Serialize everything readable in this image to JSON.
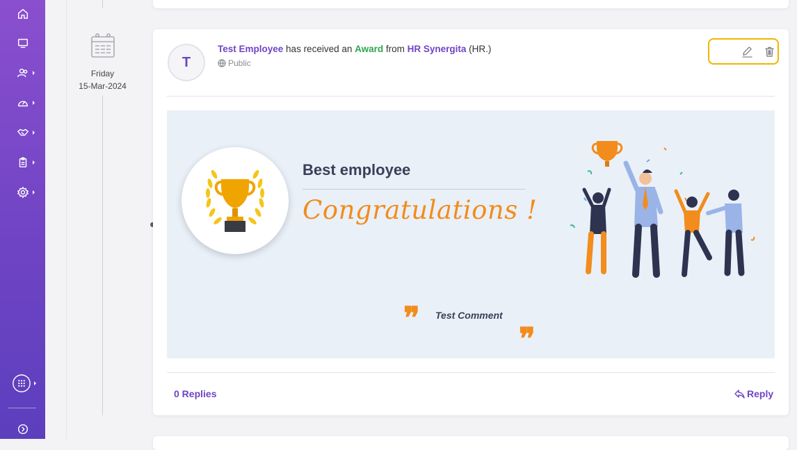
{
  "sidebar": {
    "icons": [
      "home-icon",
      "monitor-icon",
      "people-icon",
      "dashboard-gauge-icon",
      "handshake-icon",
      "clipboard-icon",
      "settings-gear-icon",
      "apps-grid-icon",
      "expand-arrow-icon"
    ]
  },
  "timeline": {
    "day": "Friday",
    "date": "15-Mar-2024"
  },
  "post": {
    "avatar_initial": "T",
    "employee_name": "Test Employee",
    "text_received": " has received an ",
    "award_word": "Award",
    "text_from": " from ",
    "giver_name": "HR Synergita",
    "giver_suffix": " (HR.)",
    "visibility": "Public",
    "award_title": "Best employee",
    "congrats_text": "Congratulations !",
    "comment": "Test Comment",
    "replies_label": "0 Replies",
    "reply_label": "Reply"
  },
  "colors": {
    "brand_purple": "#6f44c4",
    "award_green": "#2ea44f",
    "accent_orange": "#f28c1c",
    "highlight_yellow": "#f0b400",
    "banner_bg": "#e9f0f8"
  }
}
